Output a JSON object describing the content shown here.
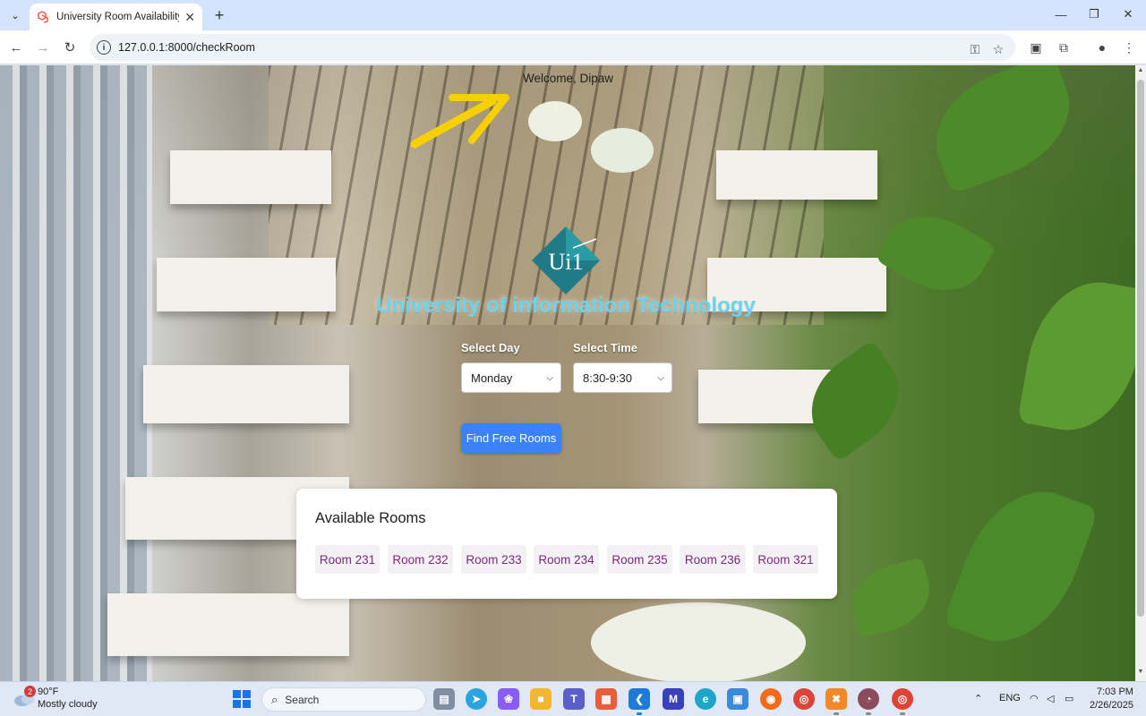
{
  "browser": {
    "tab_title": "University Room Availability Ch",
    "url": "127.0.0.1:8000/checkRoom"
  },
  "page": {
    "welcome": "Welcome, Dipaw",
    "logo_text": "Ui1",
    "university_name": "University of information Technology",
    "day_label": "Select Day",
    "day_value": "Monday",
    "time_label": "Select Time",
    "time_value": "8:30-9:30",
    "find_button": "Find Free Rooms",
    "rooms_heading": "Available Rooms",
    "rooms": [
      "Room 231",
      "Room 232",
      "Room 233",
      "Room 234",
      "Room 235",
      "Room 236",
      "Room 321"
    ]
  },
  "taskbar": {
    "weather_badge": "2",
    "weather_temp": "90°F",
    "weather_desc": "Mostly cloudy",
    "search_label": "Search",
    "language": "ENG",
    "time": "7:03 PM",
    "date": "2/26/2025"
  },
  "colors": {
    "accent_button": "#3b82f6",
    "title_cyan": "#6fd3e8",
    "room_text": "#7a2a7a",
    "logo_teal": "#1f7c86"
  }
}
